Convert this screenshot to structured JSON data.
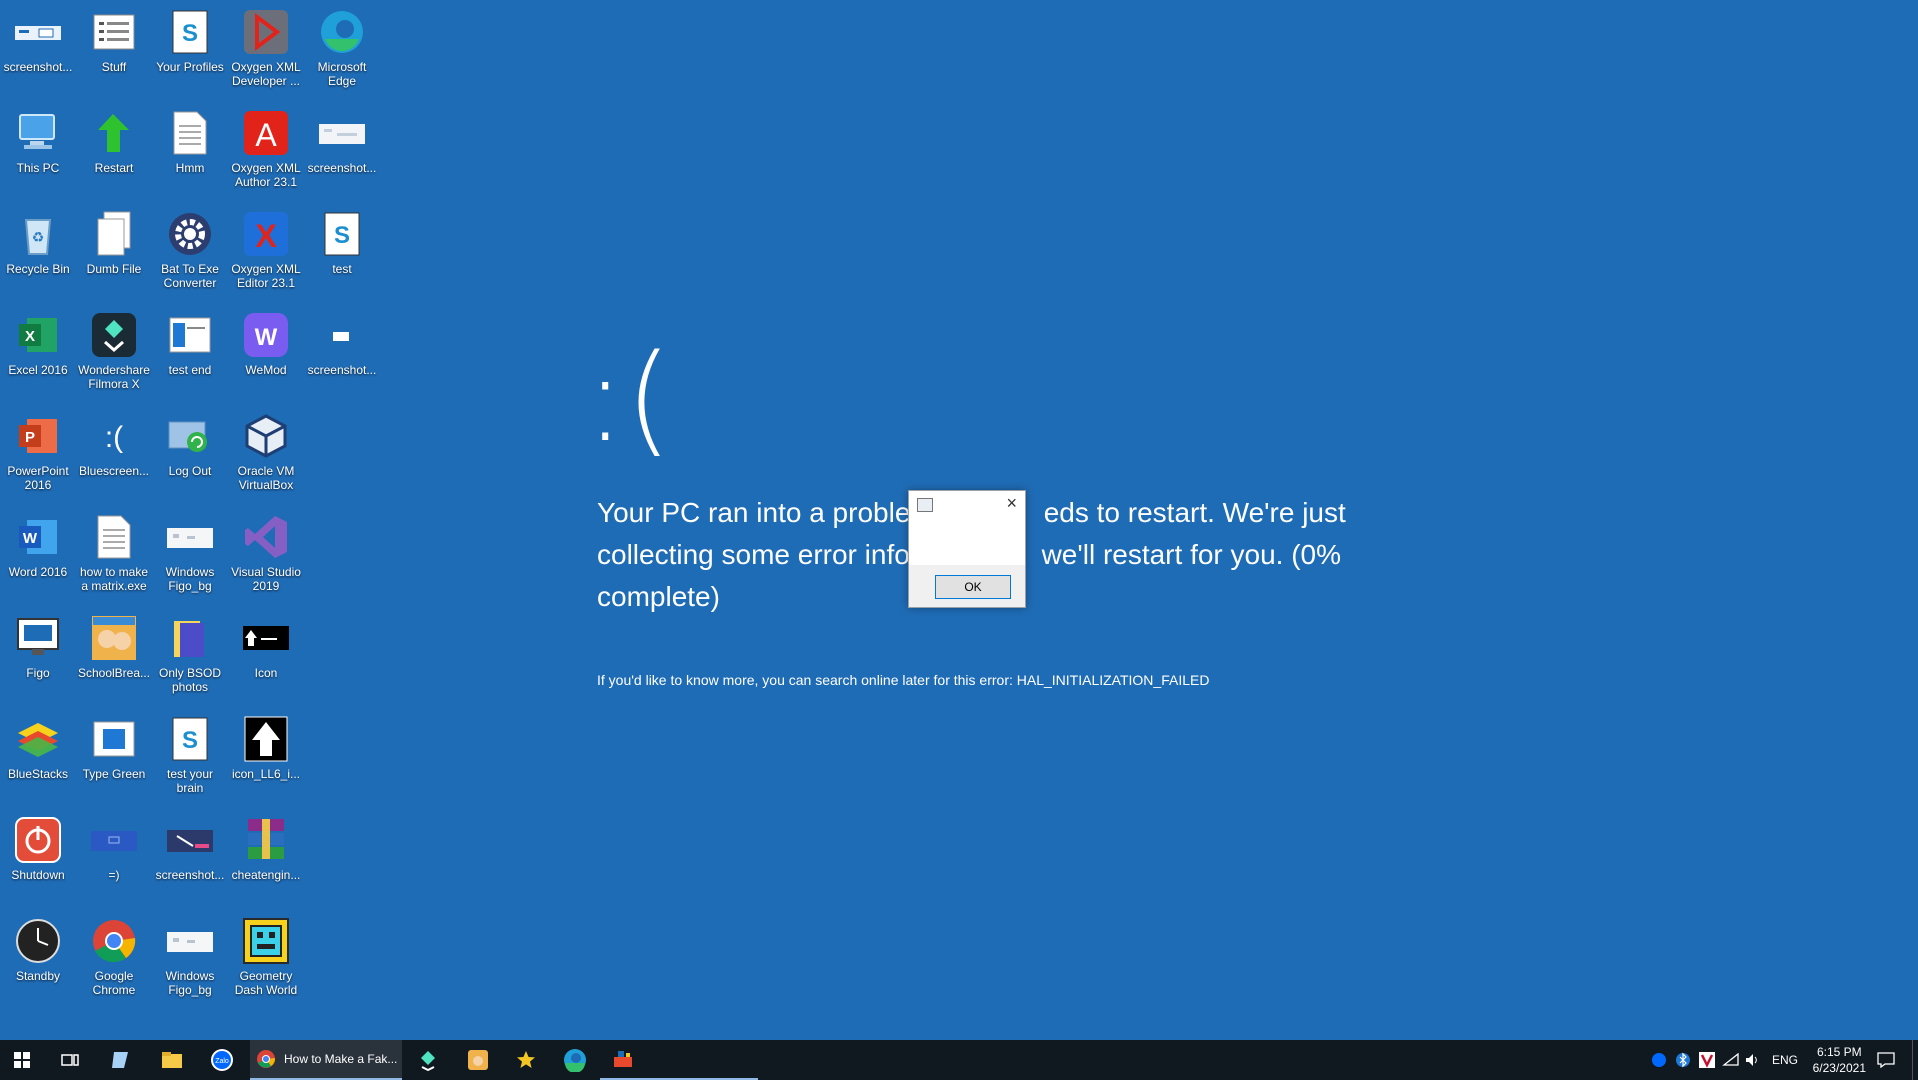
{
  "desktop_icons": [
    {
      "label": "screenshot...",
      "icon": "screenshot-thumbnail-icon"
    },
    {
      "label": "Stuff",
      "icon": "list-document-icon"
    },
    {
      "label": "Your Profiles",
      "icon": "script-icon"
    },
    {
      "label": "Oxygen XML Developer ...",
      "icon": "oxygen-developer-icon"
    },
    {
      "label": "Microsoft Edge",
      "icon": "edge-icon"
    },
    {
      "label": "This PC",
      "icon": "computer-icon"
    },
    {
      "label": "Restart",
      "icon": "green-arrow-icon"
    },
    {
      "label": "Hmm",
      "icon": "text-file-icon"
    },
    {
      "label": "Oxygen XML Author 23.1",
      "icon": "oxygen-author-icon"
    },
    {
      "label": "screenshot...",
      "icon": "screenshot-thumbnail-icon"
    },
    {
      "label": "Recycle Bin",
      "icon": "recycle-bin-icon"
    },
    {
      "label": "Dumb File",
      "icon": "files-icon"
    },
    {
      "label": "Bat To Exe Converter",
      "icon": "gear-icon"
    },
    {
      "label": "Oxygen XML Editor 23.1",
      "icon": "oxygen-editor-icon"
    },
    {
      "label": "test",
      "icon": "script-icon"
    },
    {
      "label": "Excel 2016",
      "icon": "excel-icon"
    },
    {
      "label": "Wondershare Filmora X",
      "icon": "filmora-icon"
    },
    {
      "label": "test end",
      "icon": "window-icon"
    },
    {
      "label": "WeMod",
      "icon": "wemod-icon"
    },
    {
      "label": "screenshot...",
      "icon": "screenshot-thumbnail-icon"
    },
    {
      "label": "PowerPoint 2016",
      "icon": "powerpoint-icon"
    },
    {
      "label": "Bluescreen...",
      "icon": "sad-face-icon"
    },
    {
      "label": "Log Out",
      "icon": "logout-icon"
    },
    {
      "label": "Oracle VM VirtualBox",
      "icon": "virtualbox-icon"
    },
    {
      "label": "Word 2016",
      "icon": "word-icon"
    },
    {
      "label": "how to make a matrix.exe",
      "icon": "text-file-icon"
    },
    {
      "label": "Windows Figo_bg",
      "icon": "screenshot-thumbnail-icon"
    },
    {
      "label": "Visual Studio 2019",
      "icon": "visual-studio-icon"
    },
    {
      "label": "Figo",
      "icon": "monitor-icon"
    },
    {
      "label": "SchoolBrea...",
      "icon": "game-icon"
    },
    {
      "label": "Only BSOD photos",
      "icon": "folder-icon"
    },
    {
      "label": "Icon",
      "icon": "black-thumbnail-icon"
    },
    {
      "label": "BlueStacks",
      "icon": "bluestacks-icon"
    },
    {
      "label": "Type Green",
      "icon": "window-icon"
    },
    {
      "label": "test your brain",
      "icon": "script-icon"
    },
    {
      "label": "icon_LL6_i...",
      "icon": "arrow-up-icon"
    },
    {
      "label": "Shutdown",
      "icon": "power-icon"
    },
    {
      "label": "=)",
      "icon": "screenshot-thumbnail-icon"
    },
    {
      "label": "screenshot...",
      "icon": "screenshot-thumbnail-icon"
    },
    {
      "label": "cheatengin...",
      "icon": "winrar-icon"
    },
    {
      "label": "Standby",
      "icon": "clock-icon"
    },
    {
      "label": "Google Chrome",
      "icon": "chrome-icon"
    },
    {
      "label": "Windows Figo_bg",
      "icon": "screenshot-thumbnail-icon"
    },
    {
      "label": "Geometry Dash World",
      "icon": "geometry-dash-icon"
    }
  ],
  "bsod": {
    "face": ":(",
    "message": "Your PC ran into a probler[dialog]eds to restart. We're just collecting some error info, we'll restart for you. (0% complete)",
    "message_line1_left": "Your PC ran into a probler",
    "message_line1_right": "eds to restart. We're just",
    "message_line2_left": "collecting some error info,",
    "message_line2_right": "we'll restart for you. (0%",
    "message_line3": "complete)",
    "error_line": "If you'd like to know more, you can search online later for this error: HAL_INITIALIZATION_FAILED"
  },
  "dialog": {
    "close_glyph": "×",
    "ok_label": "OK"
  },
  "taskbar": {
    "active_window_label": "How to Make a Fak...",
    "language": "ENG",
    "time": "6:15 PM",
    "date": "6/23/2021"
  },
  "colors": {
    "desktop_bg": "#1f6cb6",
    "taskbar_bg": "#101820"
  }
}
